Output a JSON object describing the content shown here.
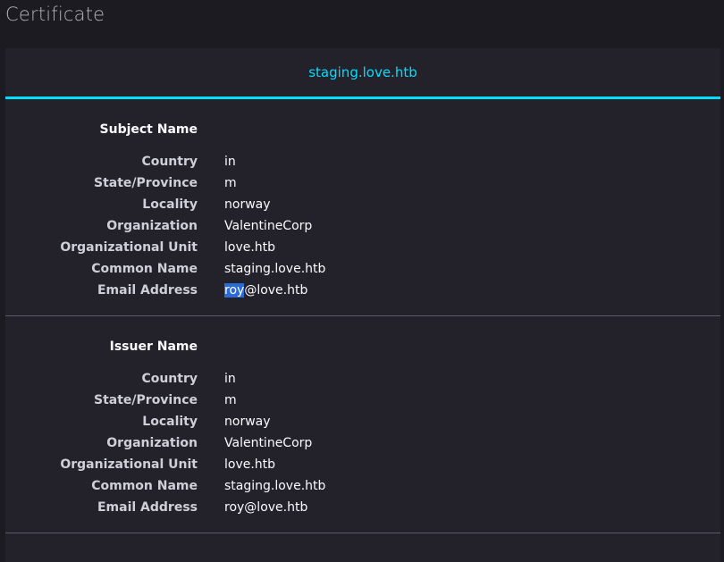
{
  "page": {
    "title": "Certificate"
  },
  "tab": {
    "label": "staging.love.htb"
  },
  "subject": {
    "title": "Subject Name",
    "rows": [
      {
        "label": "Country",
        "value": "in"
      },
      {
        "label": "State/Province",
        "value": "m"
      },
      {
        "label": "Locality",
        "value": "norway"
      },
      {
        "label": "Organization",
        "value": "ValentineCorp"
      },
      {
        "label": "Organizational Unit",
        "value": "love.htb"
      },
      {
        "label": "Common Name",
        "value": "staging.love.htb"
      },
      {
        "label": "Email Address",
        "value_selected": "roy",
        "value_rest": "@love.htb"
      }
    ]
  },
  "issuer": {
    "title": "Issuer Name",
    "rows": [
      {
        "label": "Country",
        "value": "in"
      },
      {
        "label": "State/Province",
        "value": "m"
      },
      {
        "label": "Locality",
        "value": "norway"
      },
      {
        "label": "Organization",
        "value": "ValentineCorp"
      },
      {
        "label": "Organizational Unit",
        "value": "love.htb"
      },
      {
        "label": "Common Name",
        "value": "staging.love.htb"
      },
      {
        "label": "Email Address",
        "value": "roy@love.htb"
      }
    ]
  }
}
